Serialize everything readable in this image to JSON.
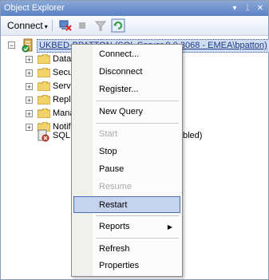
{
  "window": {
    "title": "Object Explorer",
    "controls": [
      "▾",
      "ᛸ",
      "✕"
    ]
  },
  "toolbar": {
    "connect_label": "Connect",
    "connect_arrow": "▾"
  },
  "tree": {
    "server": {
      "label": "UKBED-BPATTON (SQL Server 9.0.3068 - EMEA\\bpatton)",
      "expand": "−"
    },
    "children": [
      {
        "label": "Data",
        "expand": "+"
      },
      {
        "label": "Secu",
        "expand": "+"
      },
      {
        "label": "Serv",
        "expand": "+"
      },
      {
        "label": "Repli",
        "expand": "+"
      },
      {
        "label": "Mana",
        "expand": "+"
      },
      {
        "label": "Notif",
        "expand": "+"
      }
    ],
    "agent": {
      "label": "SQL",
      "suffix": "bled)"
    }
  },
  "context_menu": {
    "items": [
      {
        "label": "Connect...",
        "enabled": true
      },
      {
        "label": "Disconnect",
        "enabled": true
      },
      {
        "label": "Register...",
        "enabled": true
      },
      {
        "label": "New Query",
        "enabled": true
      },
      {
        "label": "Start",
        "enabled": false
      },
      {
        "label": "Stop",
        "enabled": true
      },
      {
        "label": "Pause",
        "enabled": true
      },
      {
        "label": "Resume",
        "enabled": false
      },
      {
        "label": "Restart",
        "enabled": true,
        "highlighted": true
      },
      {
        "label": "Reports",
        "enabled": true,
        "submenu_arrow": "▶"
      },
      {
        "label": "Refresh",
        "enabled": true
      },
      {
        "label": "Properties",
        "enabled": true
      }
    ]
  }
}
